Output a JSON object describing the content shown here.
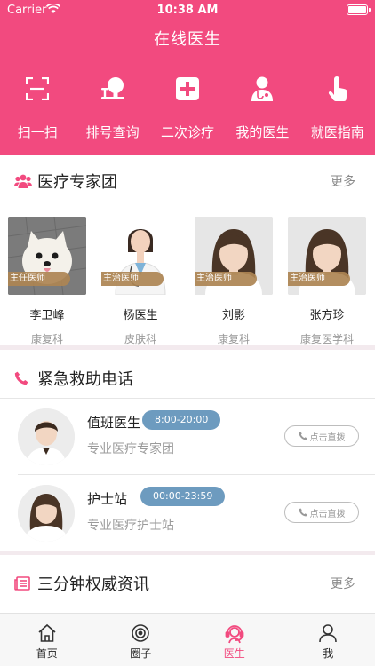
{
  "status_bar": {
    "carrier": "Carrier",
    "time": "10:38 AM"
  },
  "header": {
    "title": "在线医生"
  },
  "quick_actions": [
    {
      "label": "扫一扫",
      "icon": "scan-icon"
    },
    {
      "label": "排号查询",
      "icon": "queue-lookup-icon"
    },
    {
      "label": "二次诊疗",
      "icon": "plus-box-icon"
    },
    {
      "label": "我的医生",
      "icon": "doctor-icon"
    },
    {
      "label": "就医指南",
      "icon": "tap-hand-icon"
    }
  ],
  "experts_section": {
    "title": "医疗专家团",
    "more": "更多",
    "doctors": [
      {
        "title": "主任医师",
        "name": "李卫峰",
        "dept": "康复科",
        "photo": "dog-photo"
      },
      {
        "title": "主治医师",
        "name": "杨医生",
        "dept": "皮肤科",
        "photo": "female-doctor-photo"
      },
      {
        "title": "主治医师",
        "name": "刘影",
        "dept": "康复科",
        "photo": "default-female-avatar"
      },
      {
        "title": "主治医师",
        "name": "张方珍",
        "dept": "康复医学科",
        "photo": "default-female-avatar"
      }
    ]
  },
  "emergency_section": {
    "title": "紧急救助电话",
    "contacts": [
      {
        "name": "值班医生",
        "hours": "8:00-20:00",
        "desc": "专业医疗专家团",
        "call_label": "点击直拨",
        "avatar": "male-avatar"
      },
      {
        "name": "护士站",
        "hours": "00:00-23:59",
        "desc": "专业医疗护士站",
        "call_label": "点击直拨",
        "avatar": "female-avatar"
      }
    ]
  },
  "news_section": {
    "title": "三分钟权威资讯",
    "more": "更多"
  },
  "tabbar": {
    "items": [
      {
        "label": "首页",
        "icon": "home-icon"
      },
      {
        "label": "圈子",
        "icon": "circle-icon"
      },
      {
        "label": "医生",
        "icon": "doctor-headset-icon"
      },
      {
        "label": "我",
        "icon": "user-icon"
      }
    ],
    "active": "医生"
  },
  "colors": {
    "accent": "#f24a7f",
    "badge": "#ac8452",
    "hours_pill": "#6d9bbf"
  }
}
